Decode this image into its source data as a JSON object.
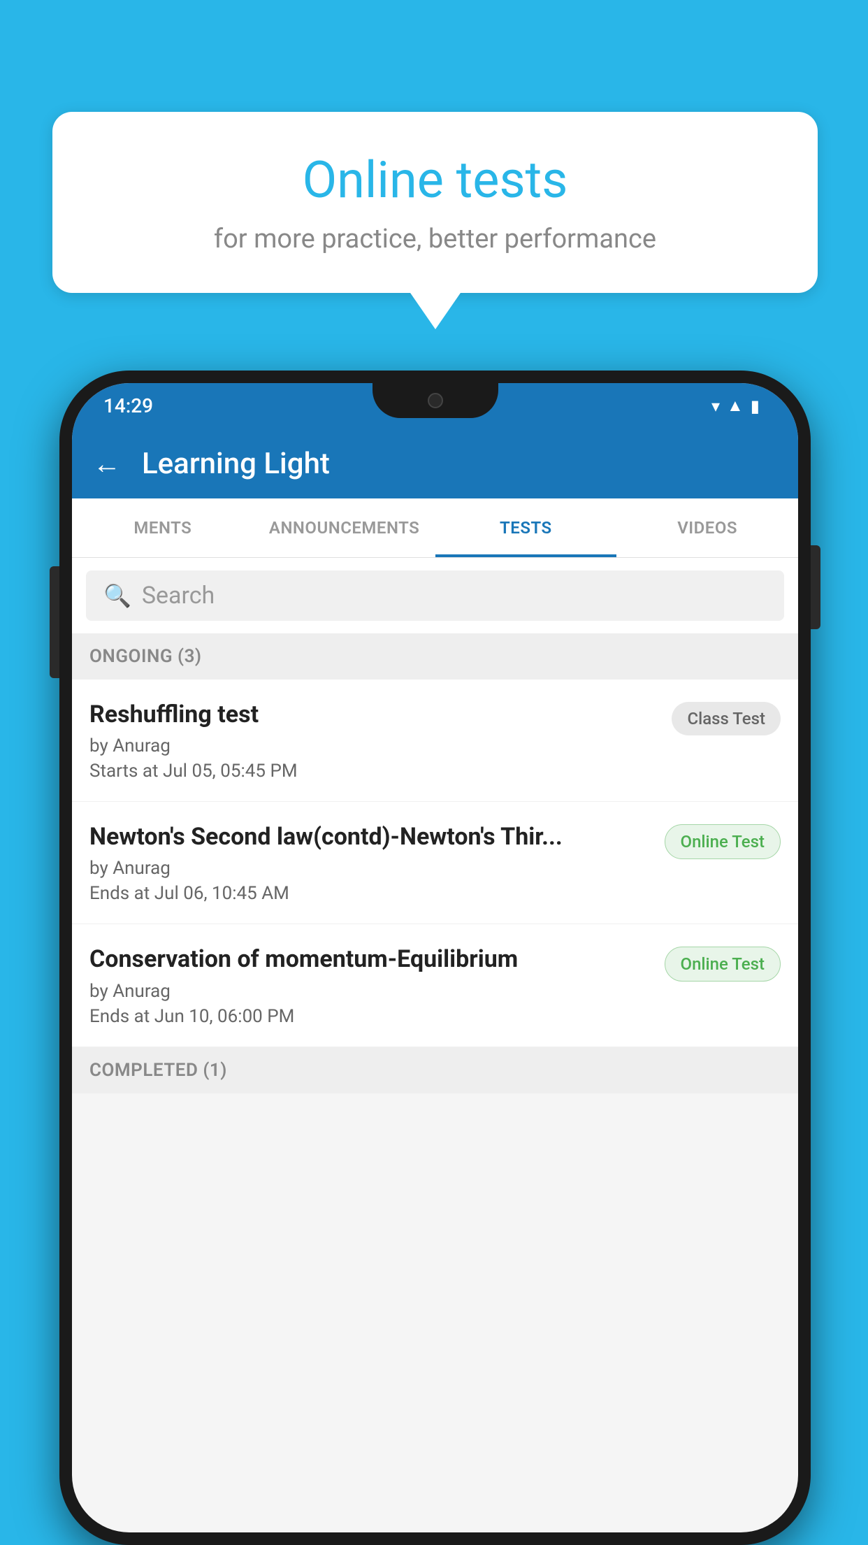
{
  "background_color": "#29b6e8",
  "speech_bubble": {
    "title": "Online tests",
    "subtitle": "for more practice, better performance"
  },
  "phone": {
    "status_bar": {
      "time": "14:29",
      "icons": [
        "wifi",
        "signal",
        "battery"
      ]
    },
    "app_bar": {
      "title": "Learning Light",
      "back_label": "←"
    },
    "tabs": [
      {
        "label": "MENTS",
        "active": false
      },
      {
        "label": "ANNOUNCEMENTS",
        "active": false
      },
      {
        "label": "TESTS",
        "active": true
      },
      {
        "label": "VIDEOS",
        "active": false
      }
    ],
    "search": {
      "placeholder": "Search"
    },
    "ongoing_section": {
      "label": "ONGOING (3)"
    },
    "tests": [
      {
        "title": "Reshuffling test",
        "author": "by Anurag",
        "date": "Starts at  Jul 05, 05:45 PM",
        "badge": "Class Test",
        "badge_type": "class"
      },
      {
        "title": "Newton's Second law(contd)-Newton's Thir...",
        "author": "by Anurag",
        "date": "Ends at  Jul 06, 10:45 AM",
        "badge": "Online Test",
        "badge_type": "online"
      },
      {
        "title": "Conservation of momentum-Equilibrium",
        "author": "by Anurag",
        "date": "Ends at  Jun 10, 06:00 PM",
        "badge": "Online Test",
        "badge_type": "online"
      }
    ],
    "completed_section": {
      "label": "COMPLETED (1)"
    }
  }
}
